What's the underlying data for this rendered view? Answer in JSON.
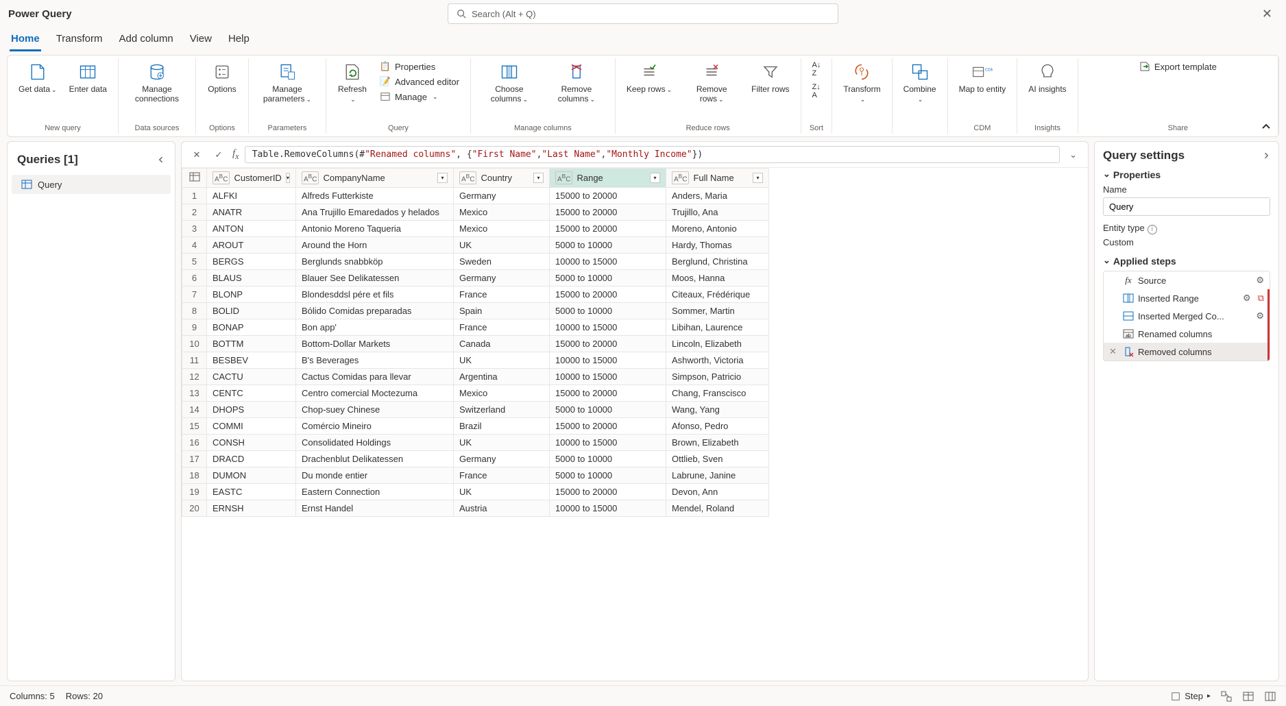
{
  "app": {
    "title": "Power Query"
  },
  "search": {
    "placeholder": "Search (Alt + Q)"
  },
  "menu": {
    "tabs": [
      "Home",
      "Transform",
      "Add column",
      "View",
      "Help"
    ],
    "active": 0
  },
  "ribbon": {
    "new_query": {
      "label": "New query",
      "get_data": "Get data",
      "enter_data": "Enter data"
    },
    "data_sources": {
      "label": "Data sources",
      "manage_connections": "Manage connections"
    },
    "options": {
      "label": "Options",
      "options": "Options"
    },
    "parameters": {
      "label": "Parameters",
      "manage_parameters": "Manage parameters"
    },
    "query": {
      "label": "Query",
      "refresh": "Refresh",
      "properties": "Properties",
      "advanced": "Advanced editor",
      "manage": "Manage"
    },
    "manage_columns": {
      "label": "Manage columns",
      "choose": "Choose columns",
      "remove": "Remove columns"
    },
    "reduce_rows": {
      "label": "Reduce rows",
      "keep": "Keep rows",
      "remove": "Remove rows",
      "filter": "Filter rows"
    },
    "sort": {
      "label": "Sort"
    },
    "transform": {
      "label": "Transform"
    },
    "combine": {
      "label": "Combine"
    },
    "cdm": {
      "label": "CDM",
      "map": "Map to entity"
    },
    "insights": {
      "label": "Insights",
      "ai": "AI insights"
    },
    "share": {
      "label": "Share",
      "export": "Export template"
    }
  },
  "queries": {
    "title": "Queries [1]",
    "items": [
      {
        "name": "Query"
      }
    ]
  },
  "formula": {
    "prefix": "Table.RemoveColumns(#",
    "arg0": "\"Renamed columns\"",
    "mid1": ", {",
    "s1": "\"First Name\"",
    "c1": ", ",
    "s2": "\"Last Name\"",
    "c2": ", ",
    "s3": "\"Monthly Income\"",
    "suffix": "})"
  },
  "table": {
    "columns": [
      {
        "name": "CustomerID",
        "type": "ABC"
      },
      {
        "name": "CompanyName",
        "type": "ABC"
      },
      {
        "name": "Country",
        "type": "ABC"
      },
      {
        "name": "Range",
        "type": "ABC",
        "selected": true
      },
      {
        "name": "Full Name",
        "type": "ABC"
      }
    ],
    "rows": [
      [
        "ALFKI",
        "Alfreds Futterkiste",
        "Germany",
        "15000 to 20000",
        "Anders, Maria"
      ],
      [
        "ANATR",
        "Ana Trujillo Emaredados y helados",
        "Mexico",
        "15000 to 20000",
        "Trujillo, Ana"
      ],
      [
        "ANTON",
        "Antonio Moreno Taqueria",
        "Mexico",
        "15000 to 20000",
        "Moreno, Antonio"
      ],
      [
        "AROUT",
        "Around the Horn",
        "UK",
        "5000 to 10000",
        "Hardy, Thomas"
      ],
      [
        "BERGS",
        "Berglunds snabbköp",
        "Sweden",
        "10000 to 15000",
        "Berglund, Christina"
      ],
      [
        "BLAUS",
        "Blauer See Delikatessen",
        "Germany",
        "5000 to 10000",
        "Moos, Hanna"
      ],
      [
        "BLONP",
        "Blondesddsl pére et fils",
        "France",
        "15000 to 20000",
        "Citeaux, Frédérique"
      ],
      [
        "BOLID",
        "Bólido Comidas preparadas",
        "Spain",
        "5000 to 10000",
        "Sommer, Martin"
      ],
      [
        "BONAP",
        "Bon app'",
        "France",
        "10000 to 15000",
        "Libihan, Laurence"
      ],
      [
        "BOTTM",
        "Bottom-Dollar Markets",
        "Canada",
        "15000 to 20000",
        "Lincoln, Elizabeth"
      ],
      [
        "BESBEV",
        "B's Beverages",
        "UK",
        "10000 to 15000",
        "Ashworth, Victoria"
      ],
      [
        "CACTU",
        "Cactus Comidas para llevar",
        "Argentina",
        "10000 to 15000",
        "Simpson, Patricio"
      ],
      [
        "CENTC",
        "Centro comercial Moctezuma",
        "Mexico",
        "15000 to 20000",
        "Chang, Franscisco"
      ],
      [
        "DHOPS",
        "Chop-suey Chinese",
        "Switzerland",
        "5000 to 10000",
        "Wang, Yang"
      ],
      [
        "COMMI",
        "Comércio Mineiro",
        "Brazil",
        "15000 to 20000",
        "Afonso, Pedro"
      ],
      [
        "CONSH",
        "Consolidated Holdings",
        "UK",
        "10000 to 15000",
        "Brown, Elizabeth"
      ],
      [
        "DRACD",
        "Drachenblut Delikatessen",
        "Germany",
        "5000 to 10000",
        "Ottlieb, Sven"
      ],
      [
        "DUMON",
        "Du monde entier",
        "France",
        "5000 to 10000",
        "Labrune, Janine"
      ],
      [
        "EASTC",
        "Eastern Connection",
        "UK",
        "15000 to 20000",
        "Devon, Ann"
      ],
      [
        "ERNSH",
        "Ernst Handel",
        "Austria",
        "10000 to 15000",
        "Mendel, Roland"
      ]
    ]
  },
  "settings": {
    "title": "Query settings",
    "properties_label": "Properties",
    "name_label": "Name",
    "name_value": "Query",
    "entity_type_label": "Entity type",
    "entity_type_value": "Custom",
    "applied_steps_label": "Applied steps",
    "steps": [
      {
        "name": "Source",
        "icon": "fx",
        "gear": true,
        "bar": false
      },
      {
        "name": "Inserted Range",
        "icon": "range",
        "gear": true,
        "bar": true,
        "warn": true
      },
      {
        "name": "Inserted Merged Co...",
        "icon": "merge",
        "gear": true,
        "bar": true
      },
      {
        "name": "Renamed columns",
        "icon": "rename",
        "gear": false,
        "bar": true
      },
      {
        "name": "Removed columns",
        "icon": "remove",
        "gear": false,
        "bar": true,
        "active": true,
        "delete": true
      }
    ]
  },
  "status": {
    "columns": "Columns: 5",
    "rows": "Rows: 20",
    "step": "Step"
  }
}
